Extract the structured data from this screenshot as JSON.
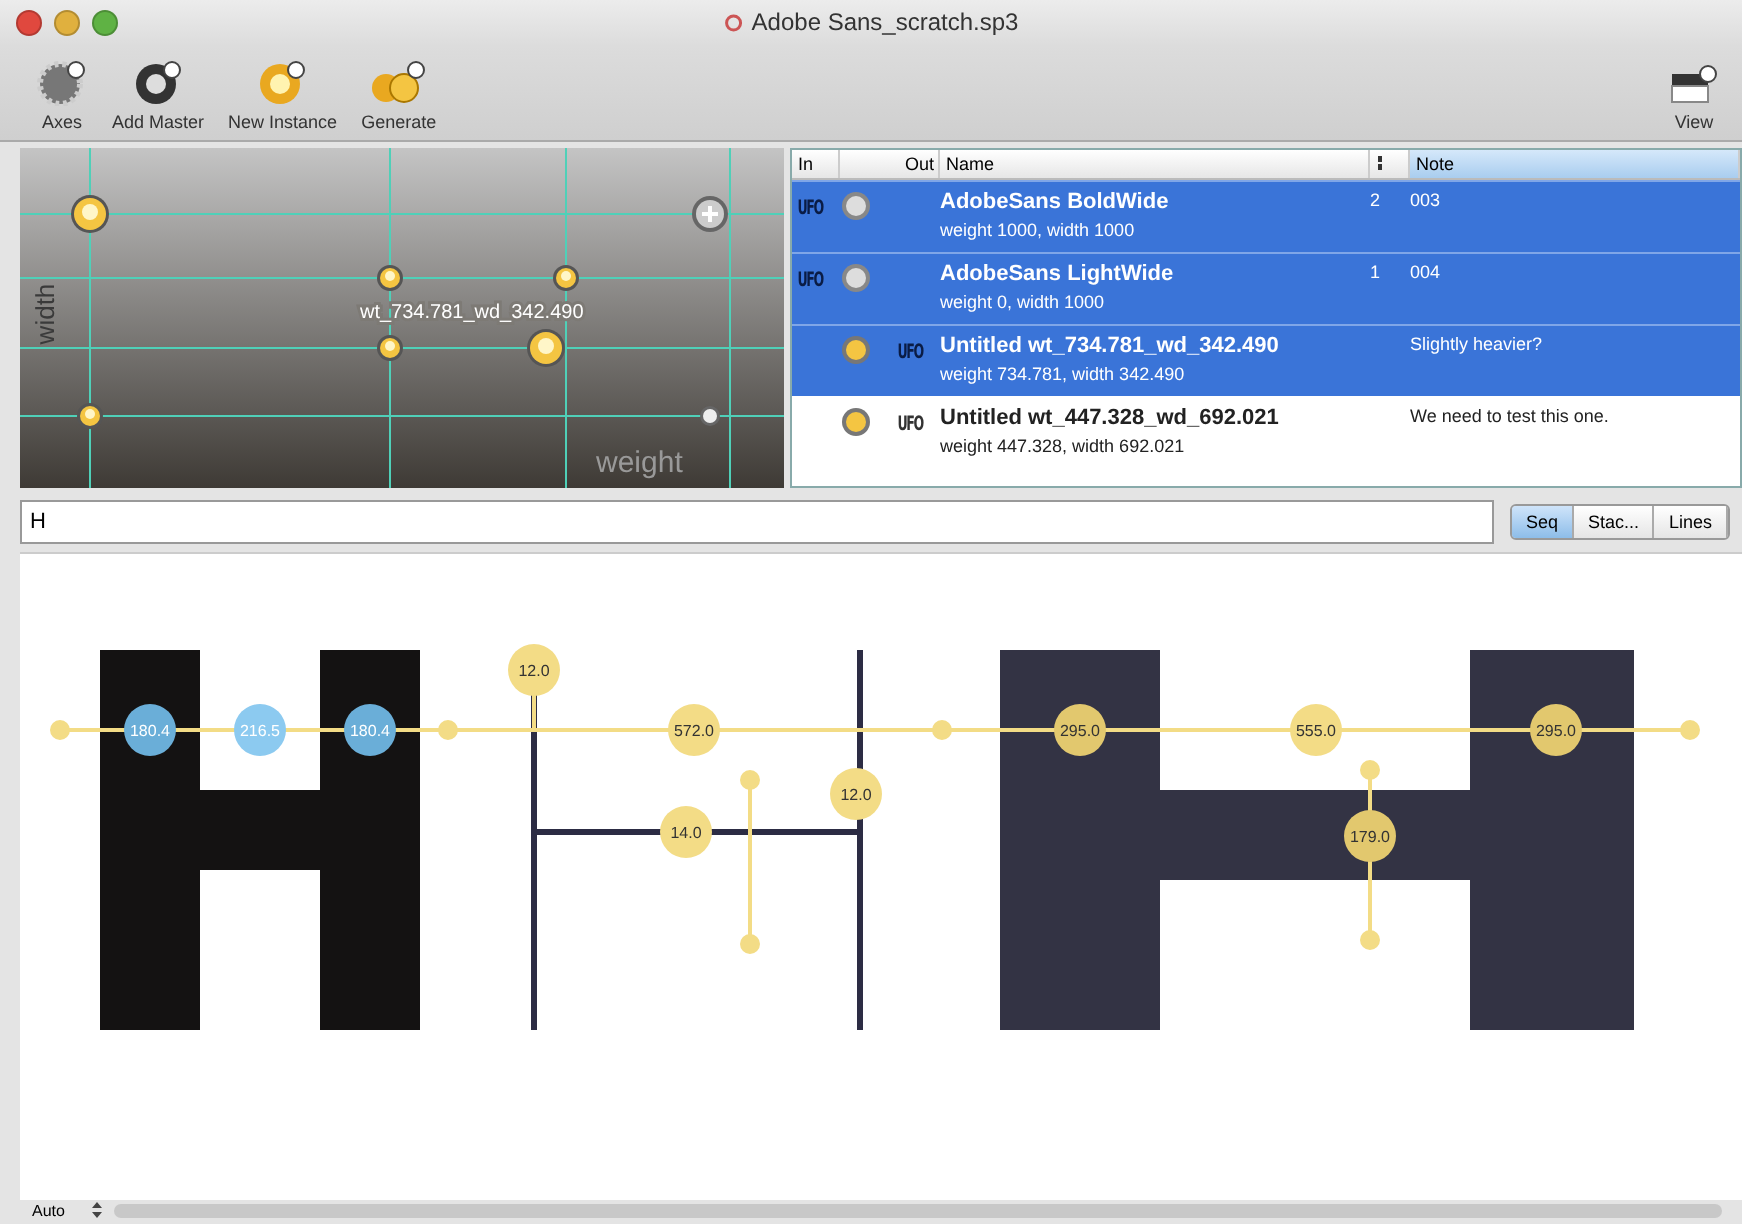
{
  "window": {
    "title": "Adobe Sans_scratch.sp3"
  },
  "toolbar": [
    {
      "label": "Axes",
      "kind": "axes"
    },
    {
      "label": "Add Master",
      "kind": "master"
    },
    {
      "label": "New Instance",
      "kind": "instance"
    },
    {
      "label": "Generate",
      "kind": "generate"
    }
  ],
  "view_button": {
    "label": "View"
  },
  "design_space": {
    "x_axis": "weight",
    "y_axis": "width",
    "point_label": "wt_734.781_wd_342.490"
  },
  "table": {
    "columns": [
      "In",
      "Out",
      "Name",
      "Note"
    ],
    "rows": [
      {
        "selected": true,
        "kind": "in",
        "tag": "UFO",
        "name": "AdobeSans BoldWide",
        "detail": "weight 1000, width 1000",
        "count": "2",
        "note": "003"
      },
      {
        "selected": true,
        "kind": "in",
        "tag": "UFO",
        "name": "AdobeSans LightWide",
        "detail": "weight 0, width 1000",
        "count": "1",
        "note": "004"
      },
      {
        "selected": true,
        "kind": "out",
        "tag": "UFO",
        "name": "Untitled wt_734.781_wd_342.490",
        "detail": "weight 734.781, width 342.490",
        "note": "Slightly heavier?"
      },
      {
        "selected": false,
        "kind": "out",
        "tag": "UFO",
        "name": "Untitled wt_447.328_wd_692.021",
        "detail": "weight 447.328, width 692.021",
        "note": "We need to test this one."
      }
    ]
  },
  "text_field": {
    "value": "H"
  },
  "modes": [
    {
      "label": "Seq",
      "selected": true
    },
    {
      "label": "Stac...",
      "selected": false
    },
    {
      "label": "Lines",
      "selected": false
    }
  ],
  "measurements": [
    {
      "value": "180.4",
      "color": "#6aaed8"
    },
    {
      "value": "216.5",
      "color": "#8ccaf0"
    },
    {
      "value": "180.4",
      "color": "#6aaed8"
    },
    {
      "value": "12.0",
      "color": "#f3dc86"
    },
    {
      "value": "572.0",
      "color": "#f3dc86"
    },
    {
      "value": "14.0",
      "color": "#f3dc86"
    },
    {
      "value": "12.0",
      "color": "#f3dc86"
    },
    {
      "value": "295.0",
      "color": "#e2c86e"
    },
    {
      "value": "555.0",
      "color": "#f3dc86"
    },
    {
      "value": "295.0",
      "color": "#e2c86e"
    },
    {
      "value": "179.0",
      "color": "#e2c86e"
    }
  ],
  "zoom": {
    "value": "Auto"
  }
}
